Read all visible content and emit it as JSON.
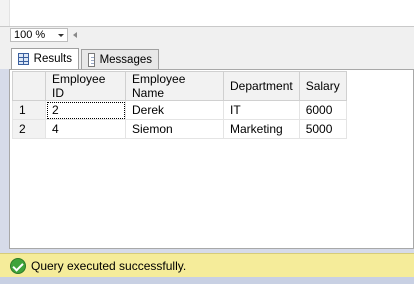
{
  "zoom": {
    "value": "100 %"
  },
  "tabs": [
    {
      "label": "Results",
      "icon": "grid-icon",
      "active": true
    },
    {
      "label": "Messages",
      "icon": "messages-icon",
      "active": false
    }
  ],
  "results": {
    "columns": [
      "Employee ID",
      "Employee Name",
      "Department",
      "Salary"
    ],
    "rows": [
      {
        "num": "1",
        "cells": [
          "2",
          "Derek",
          "IT",
          "6000"
        ]
      },
      {
        "num": "2",
        "cells": [
          "4",
          "Siemon",
          "Marketing",
          "5000"
        ]
      }
    ]
  },
  "status": {
    "text": "Query executed successfully.",
    "color": "#f5ec9a"
  }
}
